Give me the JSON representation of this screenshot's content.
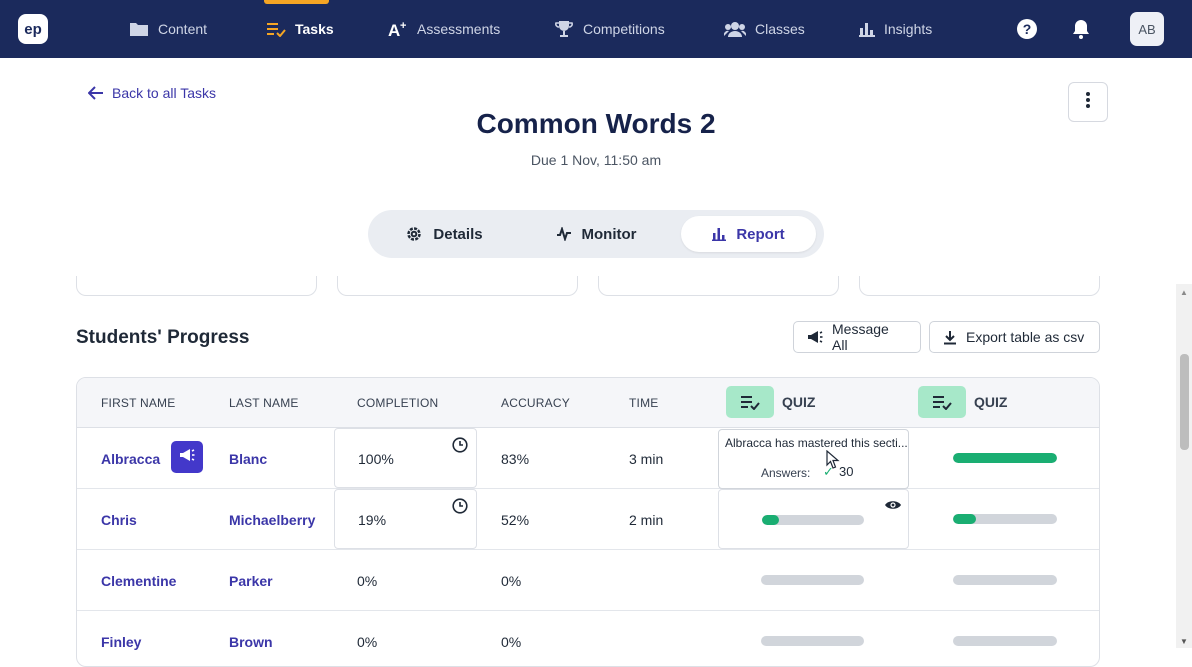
{
  "nav": {
    "logo": "ep",
    "items": [
      {
        "label": "Content",
        "icon": "folder-icon"
      },
      {
        "label": "Tasks",
        "icon": "tasks-icon",
        "active": true
      },
      {
        "label": "Assessments",
        "icon": "assessment-icon"
      },
      {
        "label": "Competitions",
        "icon": "trophy-icon"
      },
      {
        "label": "Classes",
        "icon": "users-icon"
      },
      {
        "label": "Insights",
        "icon": "chart-icon"
      }
    ],
    "help": "?",
    "avatar": "AB",
    "accent": "#f5a524",
    "bg": "#1b2a5c"
  },
  "header": {
    "back_label": "Back to all Tasks",
    "title": "Common Words 2",
    "due": "Due 1 Nov, 11:50 am"
  },
  "tabs": [
    {
      "label": "Details",
      "icon": "gear-icon"
    },
    {
      "label": "Monitor",
      "icon": "pulse-icon"
    },
    {
      "label": "Report",
      "icon": "bar-chart-icon",
      "active": true
    }
  ],
  "progress": {
    "title": "Students' Progress",
    "message_all": "Message All",
    "export": "Export table as csv",
    "columns": [
      "FIRST NAME",
      "LAST NAME",
      "COMPLETION",
      "ACCURACY",
      "TIME"
    ],
    "quiz_label": "QUIZ",
    "rows": [
      {
        "first": "Albracca",
        "last": "Blanc",
        "completion": "100%",
        "accuracy": "83%",
        "time": "3 min",
        "quiz1": 1.0,
        "quiz2": 1.0
      },
      {
        "first": "Chris",
        "last": "Michaelberry",
        "completion": "19%",
        "accuracy": "52%",
        "time": "2 min",
        "quiz1": 0.17,
        "quiz2": 0.22
      },
      {
        "first": "Clementine",
        "last": "Parker",
        "completion": "0%",
        "accuracy": "0%",
        "time": "",
        "quiz1": 0,
        "quiz2": 0
      },
      {
        "first": "Finley",
        "last": "Brown",
        "completion": "0%",
        "accuracy": "0%",
        "time": "",
        "quiz1": 0,
        "quiz2": 0
      }
    ],
    "tooltip": {
      "text": "Albracca has mastered this secti...",
      "answers_label": "Answers:",
      "answers_value": "30"
    }
  },
  "colors": {
    "accent": "#3b36a8",
    "success": "#1aae72",
    "quiz_badge": "#a7e8c9"
  }
}
